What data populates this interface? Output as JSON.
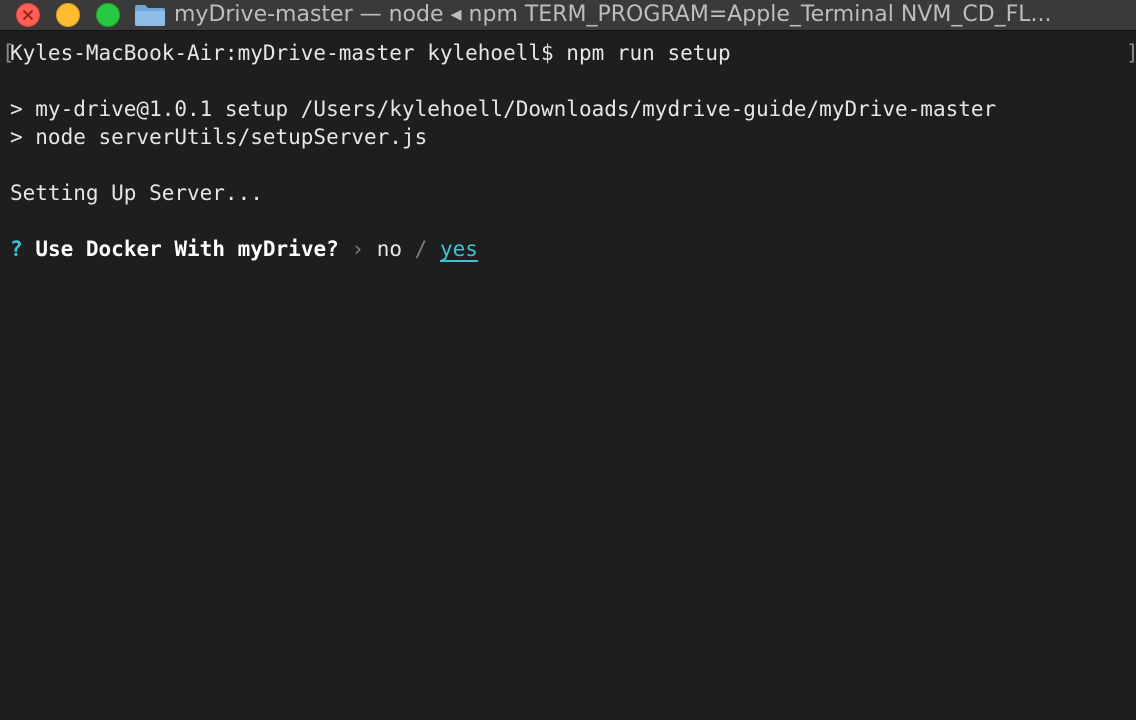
{
  "window": {
    "title": "myDrive-master — node ◂ npm TERM_PROGRAM=Apple_Terminal NVM_CD_FL..."
  },
  "terminal": {
    "prompt": "Kyles-MacBook-Air:myDrive-master kylehoell$ npm run setup",
    "script_line": "> my-drive@1.0.1 setup /Users/kylehoell/Downloads/mydrive-guide/myDrive-master",
    "command_line": "> node serverUtils/setupServer.js",
    "status_line": "Setting Up Server...",
    "question": {
      "mark": "?",
      "text": "Use Docker With myDrive?",
      "separator": "›",
      "option_no": "no",
      "slash": "/",
      "option_yes": "yes"
    }
  },
  "colors": {
    "background": "#1e1e1e",
    "titlebar": "#3a3a3a",
    "accent_cyan": "#3fc2cf",
    "text": "#e6e6e6"
  },
  "icons": [
    "close-icon",
    "minimize-icon",
    "maximize-icon",
    "folder-icon"
  ]
}
